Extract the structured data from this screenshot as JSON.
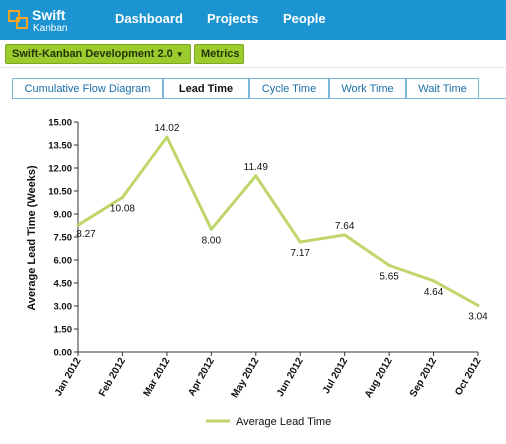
{
  "app": {
    "logo_line1": "Swift",
    "logo_line2": "Kanban"
  },
  "nav": {
    "items": [
      {
        "label": "Dashboard"
      },
      {
        "label": "Projects"
      },
      {
        "label": "People"
      }
    ]
  },
  "breadcrumb": {
    "project": "Swift-Kanban Development 2.0",
    "section": "Metrics"
  },
  "tabs": [
    {
      "label": "Cumulative Flow Diagram",
      "active": false
    },
    {
      "label": "Lead Time",
      "active": true
    },
    {
      "label": "Cycle Time",
      "active": false
    },
    {
      "label": "Work Time",
      "active": false
    },
    {
      "label": "Wait Time",
      "active": false
    }
  ],
  "colors": {
    "header": "#1b94d1",
    "accent": "#9ccb2d",
    "series": "#bfd66b"
  },
  "chart_data": {
    "type": "line",
    "categories": [
      "Jan 2012",
      "Feb 2012",
      "Mar 2012",
      "Apr 2012",
      "May 2012",
      "Jun 2012",
      "Jul 2012",
      "Aug 2012",
      "Sep 2012",
      "Oct 2012"
    ],
    "series": [
      {
        "name": "Average Lead Time",
        "values": [
          8.27,
          10.08,
          14.02,
          8.0,
          11.49,
          7.17,
          7.64,
          5.65,
          4.64,
          3.04
        ],
        "labels": [
          "8.27",
          "10.08",
          "14.02",
          "8.00",
          "11.49",
          "7.17",
          "7.64",
          "5.65",
          "4.64",
          "3.04"
        ]
      }
    ],
    "ylabel": "Average Lead Time (Weeks)",
    "xlabel": "",
    "ylim": [
      0,
      15
    ],
    "yticks": [
      "0.00",
      "1.50",
      "3.00",
      "4.50",
      "6.00",
      "7.50",
      "9.00",
      "10.50",
      "12.00",
      "13.50",
      "15.00"
    ],
    "grid": false,
    "legend": "bottom"
  }
}
